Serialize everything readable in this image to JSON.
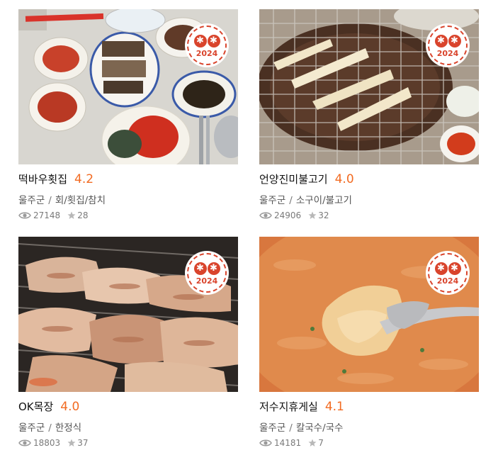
{
  "cards": [
    {
      "name": "떡바우횟집",
      "rating": "4.2",
      "area": "울주군",
      "category": "회/횟집/참치",
      "views": "27148",
      "stars": "28",
      "badge_year": "2024"
    },
    {
      "name": "언양진미불고기",
      "rating": "4.0",
      "area": "울주군",
      "category": "소구이/불고기",
      "views": "24906",
      "stars": "32",
      "badge_year": "2024"
    },
    {
      "name": "OK목장",
      "rating": "4.0",
      "area": "울주군",
      "category": "한정식",
      "views": "18803",
      "stars": "37",
      "badge_year": "2024"
    },
    {
      "name": "저수지휴게실",
      "rating": "4.1",
      "area": "울주군",
      "category": "칼국수/국수",
      "views": "14181",
      "stars": "7",
      "badge_year": "2024"
    }
  ],
  "icons": {
    "views": "eye-icon",
    "stars": "star-icon",
    "badge": "award-badge-icon"
  },
  "colors": {
    "rating": "#f26b22",
    "badge": "#d9442c"
  },
  "separator": "/",
  "badge_glyph": "✱"
}
